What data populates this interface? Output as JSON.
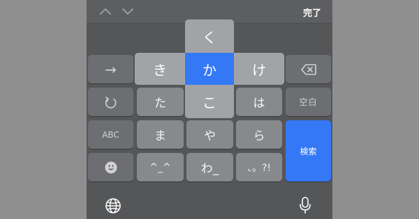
{
  "toolbar": {
    "done_label": "完了",
    "up_icon": "chevron-up-icon",
    "down_icon": "chevron-down-icon"
  },
  "keys": {
    "arrow_right": "→",
    "undo_icon": "undo-icon",
    "abc": "ABC",
    "emoji_icon": "emoji-icon",
    "ta": "た",
    "ma": "ま",
    "kaomoji": "^_^",
    "ya": "や",
    "wa": "わ_",
    "ha": "は",
    "ra": "ら",
    "punct": "、。?!",
    "delete_icon": "delete-icon",
    "space": "空白",
    "search": "検索"
  },
  "flick": {
    "up": "く",
    "left": "き",
    "center": "か",
    "right": "け",
    "down": "こ"
  },
  "bottom": {
    "globe_icon": "globe-icon",
    "mic_icon": "microphone-icon"
  },
  "colors": {
    "accent": "#3478f6",
    "keyboard_bg": "#555658",
    "char_key": "#88898c",
    "func_key": "#6d6e71",
    "flick_popup": "#a2a3a6"
  }
}
